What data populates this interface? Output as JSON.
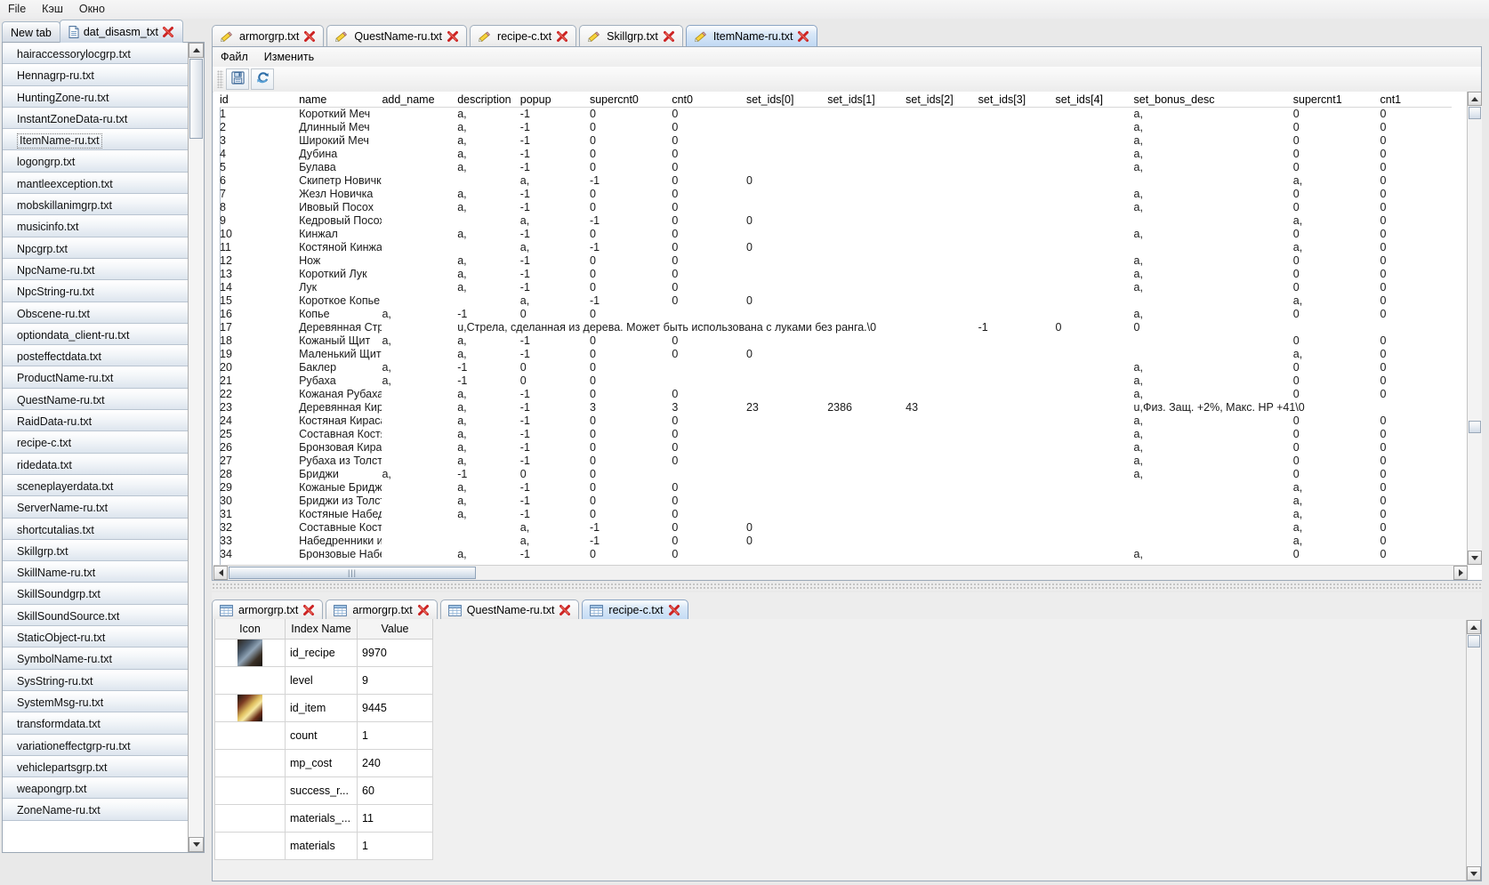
{
  "menubar": {
    "items": [
      "File",
      "Кэш",
      "Окно"
    ]
  },
  "left_panel": {
    "tabs": [
      {
        "label": "New tab",
        "icon": "none",
        "active": false,
        "closable": false
      },
      {
        "label": "dat_disasm_txt",
        "icon": "document-icon",
        "active": true,
        "closable": true
      }
    ],
    "files": [
      "hairaccessorylocgrp.txt",
      "Hennagrp-ru.txt",
      "HuntingZone-ru.txt",
      "InstantZoneData-ru.txt",
      "ItemName-ru.txt",
      "logongrp.txt",
      "mantleexception.txt",
      "mobskillanimgrp.txt",
      "musicinfo.txt",
      "Npcgrp.txt",
      "NpcName-ru.txt",
      "NpcString-ru.txt",
      "Obscene-ru.txt",
      "optiondata_client-ru.txt",
      "posteffectdata.txt",
      "ProductName-ru.txt",
      "QuestName-ru.txt",
      "RaidData-ru.txt",
      "recipe-c.txt",
      "ridedata.txt",
      "sceneplayerdata.txt",
      "ServerName-ru.txt",
      "shortcutalias.txt",
      "Skillgrp.txt",
      "SkillName-ru.txt",
      "SkillSoundgrp.txt",
      "SkillSoundSource.txt",
      "StaticObject-ru.txt",
      "SymbolName-ru.txt",
      "SysString-ru.txt",
      "SystemMsg-ru.txt",
      "transformdata.txt",
      "variationeffectgrp-ru.txt",
      "vehiclepartsgrp.txt",
      "weapongrp.txt",
      "ZoneName-ru.txt"
    ],
    "selected_file": "ItemName-ru.txt"
  },
  "editor": {
    "tabs": [
      {
        "label": "armorgrp.txt",
        "active": false
      },
      {
        "label": "QuestName-ru.txt",
        "active": false
      },
      {
        "label": "recipe-c.txt",
        "active": false
      },
      {
        "label": "Skillgrp.txt",
        "active": false
      },
      {
        "label": "ItemName-ru.txt",
        "active": true
      }
    ],
    "inner_menu": [
      "Файл",
      "Изменить"
    ],
    "toolbar_buttons": [
      {
        "name": "save-icon",
        "tooltip": ""
      },
      {
        "name": "reload-icon",
        "tooltip": ""
      }
    ],
    "grid": {
      "columns": [
        "id",
        "name",
        "add_name",
        "description",
        "popup",
        "supercnt0",
        "cnt0",
        "set_ids[0]",
        "set_ids[1]",
        "set_ids[2]",
        "set_ids[3]",
        "set_ids[4]",
        "set_bonus_desc",
        "supercnt1",
        "cnt1"
      ],
      "rows": [
        {
          "id": "1",
          "name": "Короткий Меч",
          "add_name": "",
          "description": "a,",
          "popup": "-1",
          "supercnt0": "0",
          "cnt0": "0",
          "set0": "",
          "set1": "",
          "set2": "",
          "set3": "",
          "set4": "",
          "bonus": "a,",
          "supercnt1": "0",
          "cnt1": "0",
          "wide": false
        },
        {
          "id": "2",
          "name": "Длинный Меч",
          "add_name": "",
          "description": "a,",
          "popup": "-1",
          "supercnt0": "0",
          "cnt0": "0",
          "set0": "",
          "set1": "",
          "set2": "",
          "set3": "",
          "set4": "",
          "bonus": "a,",
          "supercnt1": "0",
          "cnt1": "0",
          "wide": false
        },
        {
          "id": "3",
          "name": "Широкий Меч",
          "add_name": "",
          "description": "a,",
          "popup": "-1",
          "supercnt0": "0",
          "cnt0": "0",
          "set0": "",
          "set1": "",
          "set2": "",
          "set3": "",
          "set4": "",
          "bonus": "a,",
          "supercnt1": "0",
          "cnt1": "0",
          "wide": false
        },
        {
          "id": "4",
          "name": "Дубина",
          "add_name": "",
          "description": "a,",
          "popup": "-1",
          "supercnt0": "0",
          "cnt0": "0",
          "set0": "",
          "set1": "",
          "set2": "",
          "set3": "",
          "set4": "",
          "bonus": "a,",
          "supercnt1": "0",
          "cnt1": "0",
          "wide": false
        },
        {
          "id": "5",
          "name": "Булава",
          "add_name": "",
          "description": "a,",
          "popup": "-1",
          "supercnt0": "0",
          "cnt0": "0",
          "set0": "",
          "set1": "",
          "set2": "",
          "set3": "",
          "set4": "",
          "bonus": "a,",
          "supercnt1": "0",
          "cnt1": "0",
          "wide": false
        },
        {
          "id": "6",
          "name": "Скипетр Новичка",
          "add_name": "",
          "description": "",
          "popup": "a,",
          "supercnt0": "-1",
          "cnt0": "0",
          "set0": "0",
          "set1": "",
          "set2": "",
          "set3": "",
          "set4": "",
          "bonus": "",
          "supercnt1": "a,",
          "cnt1": "0",
          "wide": false
        },
        {
          "id": "7",
          "name": "Жезл Новичка",
          "add_name": "",
          "description": "a,",
          "popup": "-1",
          "supercnt0": "0",
          "cnt0": "0",
          "set0": "",
          "set1": "",
          "set2": "",
          "set3": "",
          "set4": "",
          "bonus": "a,",
          "supercnt1": "0",
          "cnt1": "0",
          "wide": false
        },
        {
          "id": "8",
          "name": "Ивовый Посох",
          "add_name": "",
          "description": "a,",
          "popup": "-1",
          "supercnt0": "0",
          "cnt0": "0",
          "set0": "",
          "set1": "",
          "set2": "",
          "set3": "",
          "set4": "",
          "bonus": "a,",
          "supercnt1": "0",
          "cnt1": "0",
          "wide": false
        },
        {
          "id": "9",
          "name": "Кедровый Посох",
          "add_name": "",
          "description": "",
          "popup": "a,",
          "supercnt0": "-1",
          "cnt0": "0",
          "set0": "0",
          "set1": "",
          "set2": "",
          "set3": "",
          "set4": "",
          "bonus": "",
          "supercnt1": "a,",
          "cnt1": "0",
          "wide": false
        },
        {
          "id": "10",
          "name": "Кинжал",
          "add_name": "",
          "description": "a,",
          "popup": "-1",
          "supercnt0": "0",
          "cnt0": "0",
          "set0": "",
          "set1": "",
          "set2": "",
          "set3": "",
          "set4": "",
          "bonus": "a,",
          "supercnt1": "0",
          "cnt1": "0",
          "wide": false
        },
        {
          "id": "11",
          "name": "Костяной Кинжал",
          "add_name": "",
          "description": "",
          "popup": "a,",
          "supercnt0": "-1",
          "cnt0": "0",
          "set0": "0",
          "set1": "",
          "set2": "",
          "set3": "",
          "set4": "",
          "bonus": "",
          "supercnt1": "a,",
          "cnt1": "0",
          "wide": false
        },
        {
          "id": "12",
          "name": "Нож",
          "add_name": "",
          "description": "a,",
          "popup": "-1",
          "supercnt0": "0",
          "cnt0": "0",
          "set0": "",
          "set1": "",
          "set2": "",
          "set3": "",
          "set4": "",
          "bonus": "a,",
          "supercnt1": "0",
          "cnt1": "0",
          "wide": false
        },
        {
          "id": "13",
          "name": "Короткий Лук",
          "add_name": "",
          "description": "a,",
          "popup": "-1",
          "supercnt0": "0",
          "cnt0": "0",
          "set0": "",
          "set1": "",
          "set2": "",
          "set3": "",
          "set4": "",
          "bonus": "a,",
          "supercnt1": "0",
          "cnt1": "0",
          "wide": false
        },
        {
          "id": "14",
          "name": "Лук",
          "add_name": "",
          "description": "a,",
          "popup": "-1",
          "supercnt0": "0",
          "cnt0": "0",
          "set0": "",
          "set1": "",
          "set2": "",
          "set3": "",
          "set4": "",
          "bonus": "a,",
          "supercnt1": "0",
          "cnt1": "0",
          "wide": false
        },
        {
          "id": "15",
          "name": "Короткое Копье",
          "add_name": "",
          "description": "",
          "popup": "a,",
          "supercnt0": "-1",
          "cnt0": "0",
          "set0": "0",
          "set1": "",
          "set2": "",
          "set3": "",
          "set4": "",
          "bonus": "",
          "supercnt1": "a,",
          "cnt1": "0",
          "wide": false
        },
        {
          "id": "16",
          "name": "Копье",
          "add_name": "a,",
          "description": "-1",
          "popup": "0",
          "supercnt0": "0",
          "cnt0": "",
          "set0": "",
          "set1": "",
          "set2": "",
          "set3": "",
          "set4": "",
          "bonus": "a,",
          "supercnt1": "0",
          "cnt1": "0",
          "wide": false
        },
        {
          "id": "17",
          "name": "Деревянная Стрела",
          "add_name": "",
          "description": "u,Стрела, сделанная из дерева. Может быть использована с луками без ранга.\\0",
          "popup": "",
          "supercnt0": "",
          "cnt0": "",
          "set0": "",
          "set1": "",
          "set2": "",
          "set3": "-1",
          "set4": "0",
          "bonus": "0",
          "supercnt1": "",
          "cnt1": "",
          "wide": true
        },
        {
          "id": "18",
          "name": "Кожаный Щит",
          "add_name": "a,",
          "description": "a,",
          "popup": "-1",
          "supercnt0": "0",
          "cnt0": "0",
          "set0": "",
          "set1": "",
          "set2": "",
          "set3": "",
          "set4": "",
          "bonus": "",
          "supercnt1": "0",
          "cnt1": "0",
          "wide": false
        },
        {
          "id": "19",
          "name": "Маленький Щит",
          "add_name": "",
          "description": "a,",
          "popup": "-1",
          "supercnt0": "0",
          "cnt0": "0",
          "set0": "0",
          "set1": "",
          "set2": "",
          "set3": "",
          "set4": "",
          "bonus": "",
          "supercnt1": "a,",
          "cnt1": "0",
          "wide": false
        },
        {
          "id": "20",
          "name": "Баклер",
          "add_name": "a,",
          "description": "-1",
          "popup": "0",
          "supercnt0": "0",
          "cnt0": "",
          "set0": "",
          "set1": "",
          "set2": "",
          "set3": "",
          "set4": "",
          "bonus": "a,",
          "supercnt1": "0",
          "cnt1": "0",
          "wide": false
        },
        {
          "id": "21",
          "name": "Рубаха",
          "add_name": "a,",
          "description": "-1",
          "popup": "0",
          "supercnt0": "0",
          "cnt0": "",
          "set0": "",
          "set1": "",
          "set2": "",
          "set3": "",
          "set4": "",
          "bonus": "a,",
          "supercnt1": "0",
          "cnt1": "0",
          "wide": false
        },
        {
          "id": "22",
          "name": "Кожаная Рубаха",
          "add_name": "",
          "description": "a,",
          "popup": "-1",
          "supercnt0": "0",
          "cnt0": "0",
          "set0": "",
          "set1": "",
          "set2": "",
          "set3": "",
          "set4": "",
          "bonus": "a,",
          "supercnt1": "0",
          "cnt1": "0",
          "wide": false
        },
        {
          "id": "23",
          "name": "Деревянная Кираса",
          "add_name": "",
          "description": "a,",
          "popup": "-1",
          "supercnt0": "3",
          "cnt0": "3",
          "set0": "23",
          "set1": "2386",
          "set2": "43",
          "set3": "",
          "set4": "",
          "bonus": "u,Физ. Защ. +2%, Макс. HP +41\\0",
          "supercnt1": "",
          "cnt1": "",
          "wide": true
        },
        {
          "id": "24",
          "name": "Костяная Кираса",
          "add_name": "",
          "description": "a,",
          "popup": "-1",
          "supercnt0": "0",
          "cnt0": "0",
          "set0": "",
          "set1": "",
          "set2": "",
          "set3": "",
          "set4": "",
          "bonus": "a,",
          "supercnt1": "0",
          "cnt1": "0",
          "wide": false
        },
        {
          "id": "25",
          "name": "Составная Костяная Кираса",
          "add_name": "",
          "description": "a,",
          "popup": "-1",
          "supercnt0": "0",
          "cnt0": "0",
          "set0": "",
          "set1": "",
          "set2": "",
          "set3": "",
          "set4": "",
          "bonus": "a,",
          "supercnt1": "0",
          "cnt1": "0",
          "wide": false
        },
        {
          "id": "26",
          "name": "Бронзовая Кираса",
          "add_name": "",
          "description": "a,",
          "popup": "-1",
          "supercnt0": "0",
          "cnt0": "0",
          "set0": "",
          "set1": "",
          "set2": "",
          "set3": "",
          "set4": "",
          "bonus": "a,",
          "supercnt1": "0",
          "cnt1": "0",
          "wide": false
        },
        {
          "id": "27",
          "name": "Рубаха из Толстой Кожи",
          "add_name": "",
          "description": "a,",
          "popup": "-1",
          "supercnt0": "0",
          "cnt0": "0",
          "set0": "",
          "set1": "",
          "set2": "",
          "set3": "",
          "set4": "",
          "bonus": "a,",
          "supercnt1": "0",
          "cnt1": "0",
          "wide": false
        },
        {
          "id": "28",
          "name": "Бриджи",
          "add_name": "a,",
          "description": "-1",
          "popup": "0",
          "supercnt0": "0",
          "cnt0": "",
          "set0": "",
          "set1": "",
          "set2": "",
          "set3": "",
          "set4": "",
          "bonus": "a,",
          "supercnt1": "0",
          "cnt1": "0",
          "wide": false
        },
        {
          "id": "29",
          "name": "Кожаные Бриджи",
          "add_name": "",
          "description": "a,",
          "popup": "-1",
          "supercnt0": "0",
          "cnt0": "0",
          "set0": "",
          "set1": "",
          "set2": "",
          "set3": "",
          "set4": "",
          "bonus": "",
          "supercnt1": "a,",
          "cnt1": "0",
          "wide": false
        },
        {
          "id": "30",
          "name": "Бриджи из Толстой Кожи",
          "add_name": "",
          "description": "a,",
          "popup": "-1",
          "supercnt0": "0",
          "cnt0": "0",
          "set0": "",
          "set1": "",
          "set2": "",
          "set3": "",
          "set4": "",
          "bonus": "",
          "supercnt1": "a,",
          "cnt1": "0",
          "wide": false
        },
        {
          "id": "31",
          "name": "Костяные Набедренники",
          "add_name": "",
          "description": "a,",
          "popup": "-1",
          "supercnt0": "0",
          "cnt0": "0",
          "set0": "",
          "set1": "",
          "set2": "",
          "set3": "",
          "set4": "",
          "bonus": "",
          "supercnt1": "a,",
          "cnt1": "0",
          "wide": false
        },
        {
          "id": "32",
          "name": "Составные Костяные Набедренники",
          "add_name": "",
          "description": "",
          "popup": "a,",
          "supercnt0": "-1",
          "cnt0": "0",
          "set0": "0",
          "set1": "",
          "set2": "",
          "set3": "",
          "set4": "",
          "bonus": "",
          "supercnt1": "a,",
          "cnt1": "0",
          "wide": false
        },
        {
          "id": "33",
          "name": "Набедренники из Толстой Кожи",
          "add_name": "",
          "description": "",
          "popup": "a,",
          "supercnt0": "-1",
          "cnt0": "0",
          "set0": "0",
          "set1": "",
          "set2": "",
          "set3": "",
          "set4": "",
          "bonus": "",
          "supercnt1": "a,",
          "cnt1": "0",
          "wide": false
        },
        {
          "id": "34",
          "name": "Бронзовые Набедренники",
          "add_name": "",
          "description": "a,",
          "popup": "-1",
          "supercnt0": "0",
          "cnt0": "0",
          "set0": "",
          "set1": "",
          "set2": "",
          "set3": "",
          "set4": "",
          "bonus": "a,",
          "supercnt1": "0",
          "cnt1": "0",
          "wide": false
        }
      ]
    }
  },
  "bottom": {
    "tabs": [
      {
        "label": "armorgrp.txt",
        "active": false
      },
      {
        "label": "armorgrp.txt",
        "active": false
      },
      {
        "label": "QuestName-ru.txt",
        "active": false
      },
      {
        "label": "recipe-c.txt",
        "active": true
      }
    ],
    "property_table": {
      "columns": [
        "Icon",
        "Index Name",
        "Value"
      ],
      "rows": [
        {
          "icon": "item-thumb-dark",
          "index_name": "id_recipe",
          "value": "9970"
        },
        {
          "icon": "",
          "index_name": "level",
          "value": "9"
        },
        {
          "icon": "item-thumb-gold",
          "index_name": "id_item",
          "value": "9445"
        },
        {
          "icon": "",
          "index_name": "count",
          "value": "1"
        },
        {
          "icon": "",
          "index_name": "mp_cost",
          "value": "240"
        },
        {
          "icon": "",
          "index_name": "success_r...",
          "value": "60"
        },
        {
          "icon": "",
          "index_name": "materials_...",
          "value": "11"
        },
        {
          "icon": "",
          "index_name": "materials",
          "value": "1"
        }
      ]
    }
  },
  "colors": {
    "tab_active": "#c2daf4",
    "panel_bg": "#ededed",
    "grid_bg": "#ffffff",
    "close_x": "#cc2222",
    "border": "#9aa8b8"
  }
}
